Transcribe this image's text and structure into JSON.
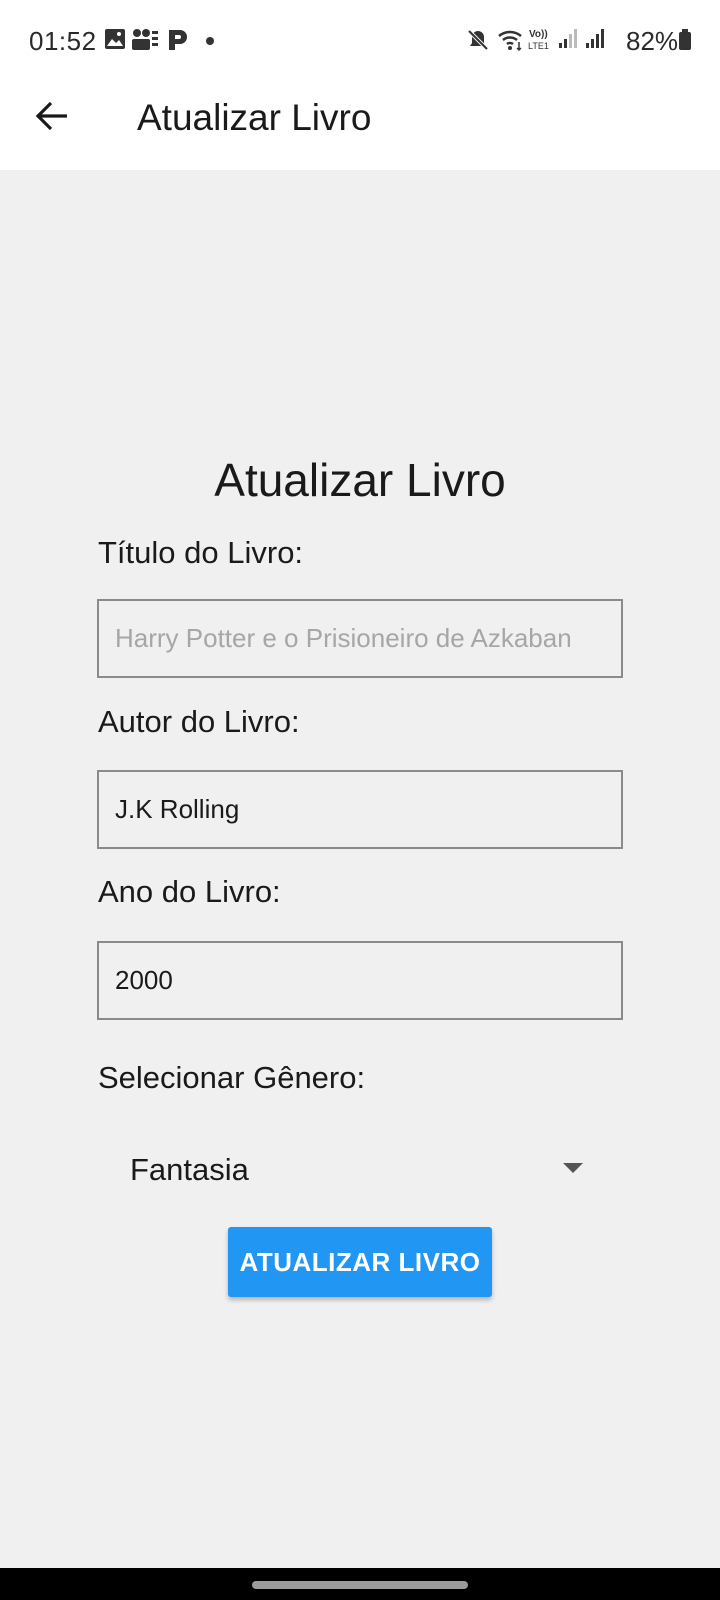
{
  "status_bar": {
    "time": "01:52",
    "battery": "82%",
    "left_icons": [
      "gallery-icon",
      "photos-icon",
      "p-app-icon"
    ],
    "right_icons": [
      "mute-icon",
      "wifi-icon",
      "volte-icon",
      "signal-icon",
      "signal-icon",
      "battery-icon"
    ],
    "volte_label": "Vo)) LTE1"
  },
  "app_bar": {
    "title": "Atualizar Livro",
    "back_icon": "arrow-back-icon"
  },
  "form": {
    "heading": "Atualizar Livro",
    "title_label": "Título do Livro:",
    "title_placeholder": "Harry Potter e o Prisioneiro de Azkaban",
    "title_value": "",
    "author_label": "Autor do Livro:",
    "author_value": "J.K Rolling",
    "year_label": "Ano do Livro:",
    "year_value": "2000",
    "genre_label": "Selecionar Gênero:",
    "genre_selected": "Fantasia",
    "submit_label": "ATUALIZAR LIVRO"
  },
  "colors": {
    "primary": "#2196f3",
    "background": "#f0f0f0",
    "app_bar": "#ffffff"
  }
}
